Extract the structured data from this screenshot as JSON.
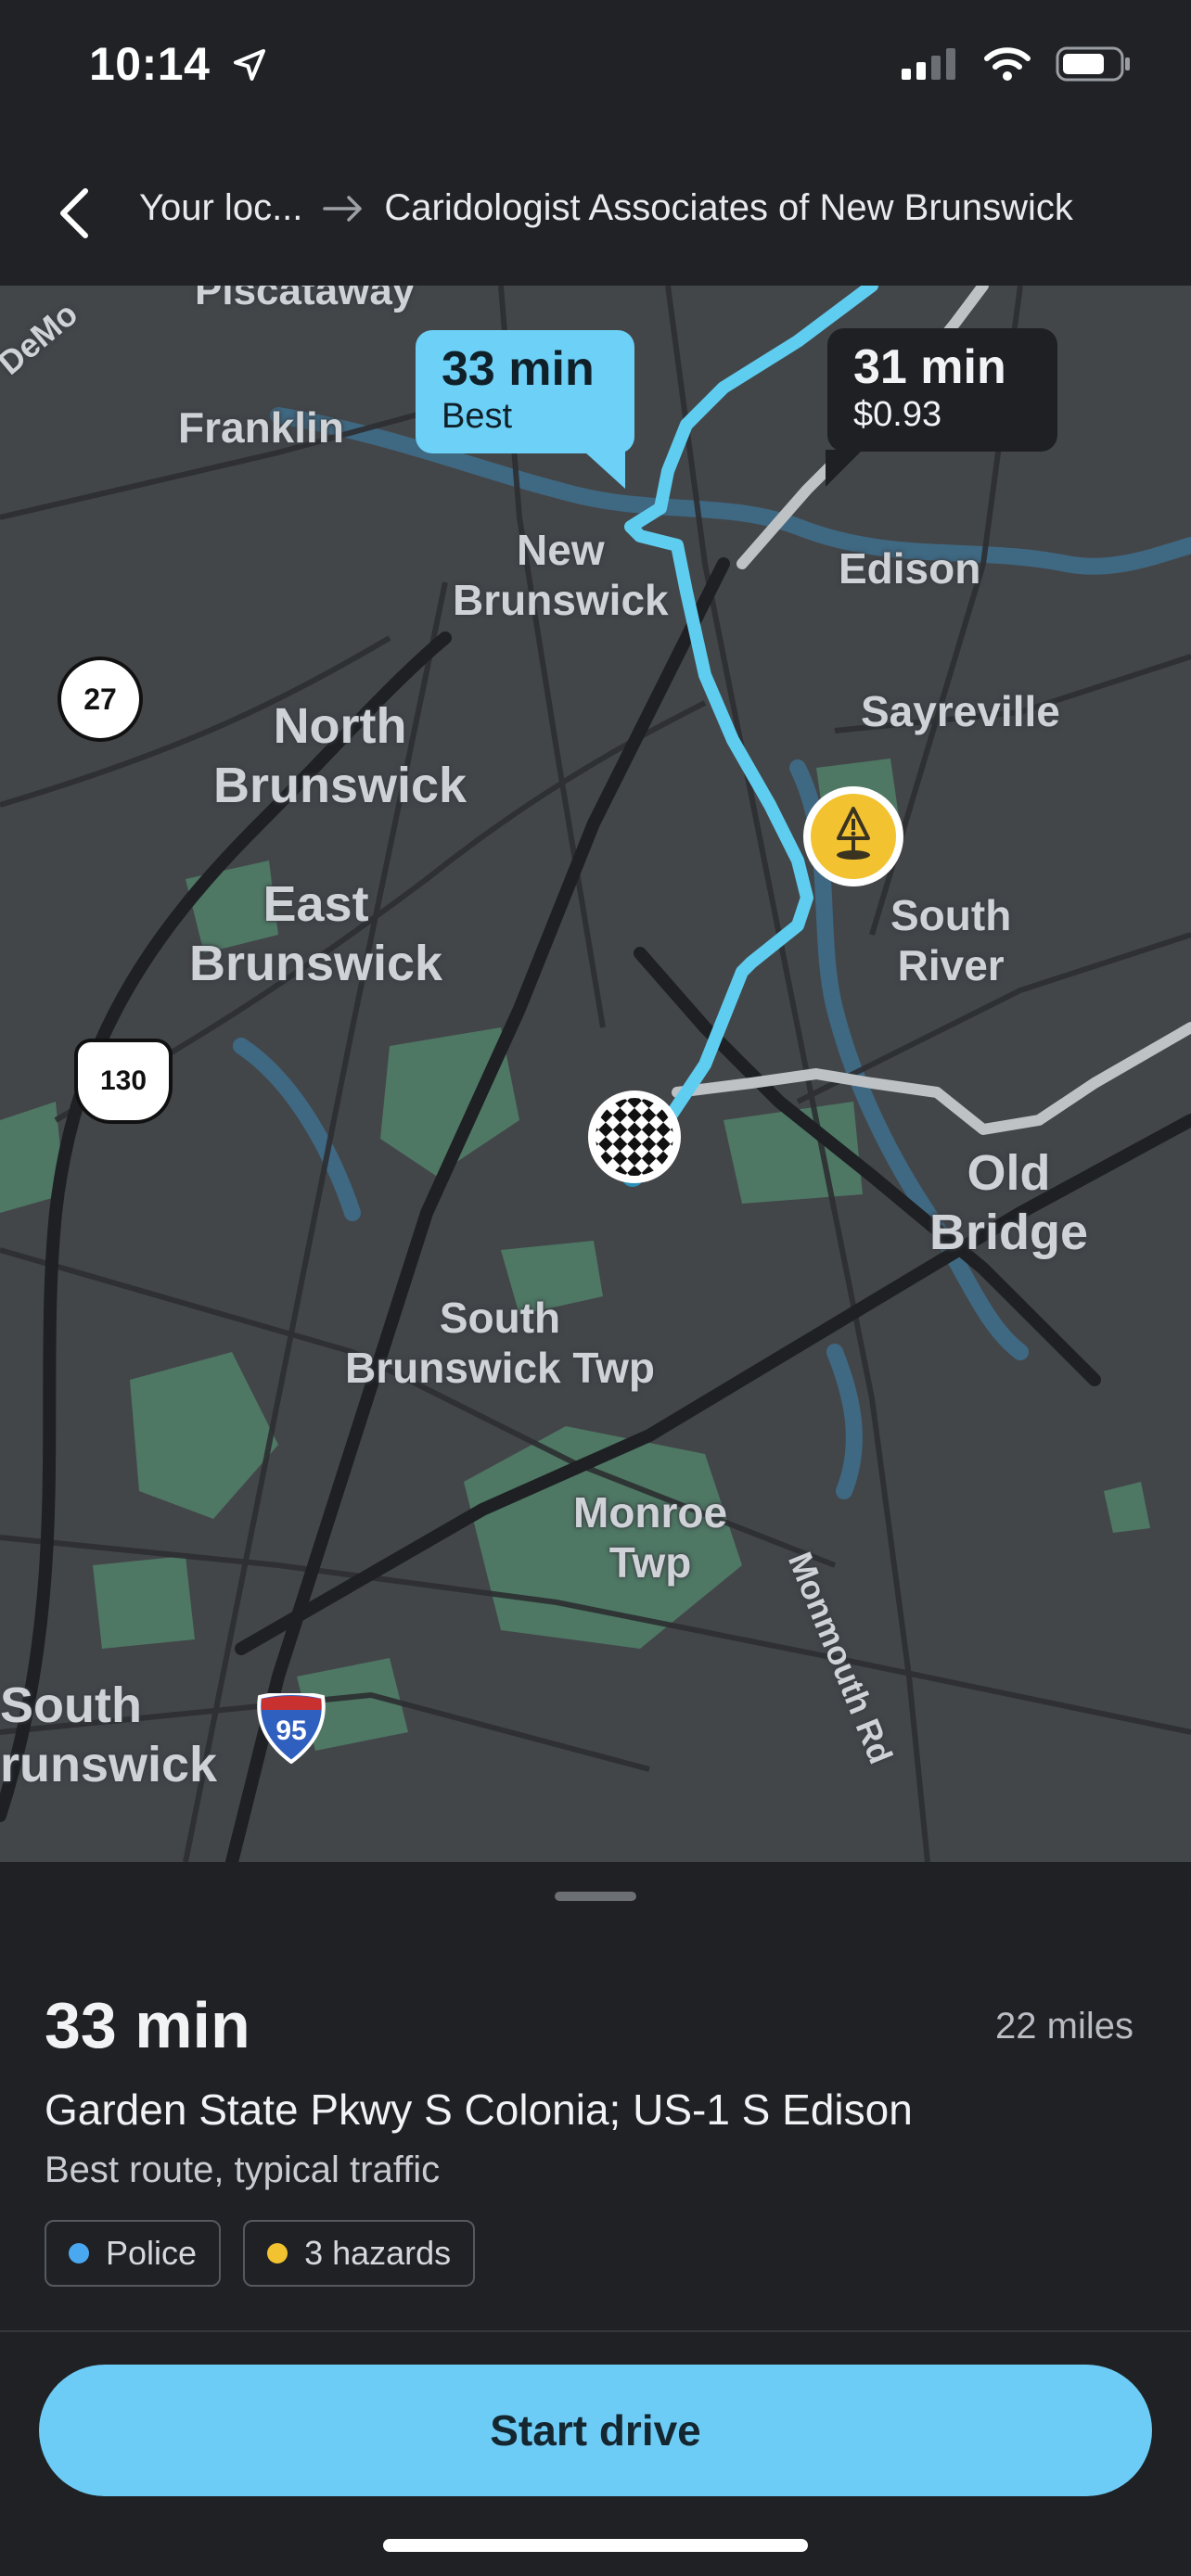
{
  "status_bar": {
    "time": "10:14"
  },
  "header": {
    "origin": "Your loc...",
    "destination": "Caridologist Associates of New Brunswick"
  },
  "map": {
    "labels": {
      "franklin": "Franklin",
      "new_brunswick": "New\nBrunswick",
      "edison": "Edison",
      "north_brunswick": "North\nBrunswick",
      "sayreville": "Sayreville",
      "east_brunswick": "East\nBrunswick",
      "south_river": "South\nRiver",
      "old_bridge": "Old\nBridge",
      "south_brunswick_twp": "South\nBrunswick Twp",
      "monroe_twp": "Monroe\nTwp",
      "monmouth_rd": "Monmouth Rd",
      "south_brunswick_edge": "South\nrunswick",
      "piscataway_cut": "Piscataway",
      "demott_cut": "DeMo"
    },
    "shields": {
      "route_27": "27",
      "route_130": "130",
      "i95": "95"
    },
    "callouts": {
      "best": {
        "time": "33 min",
        "label": "Best"
      },
      "alt": {
        "time": "31 min",
        "cost": "$0.93"
      }
    },
    "colors": {
      "route": "#5fcdf0",
      "alt_route": "#bfc2c5",
      "park": "#4f7a66",
      "water": "#3f6a86"
    }
  },
  "sheet": {
    "eta": "33 min",
    "distance": "22 miles",
    "route_name": "Garden State Pkwy S Colonia; US-1 S Edison",
    "route_desc": "Best route, typical traffic",
    "chips": [
      {
        "label": "Police",
        "color": "#4aa8f0"
      },
      {
        "label": "3 hazards",
        "color": "#f2c230"
      }
    ],
    "start_button": "Start drive"
  }
}
